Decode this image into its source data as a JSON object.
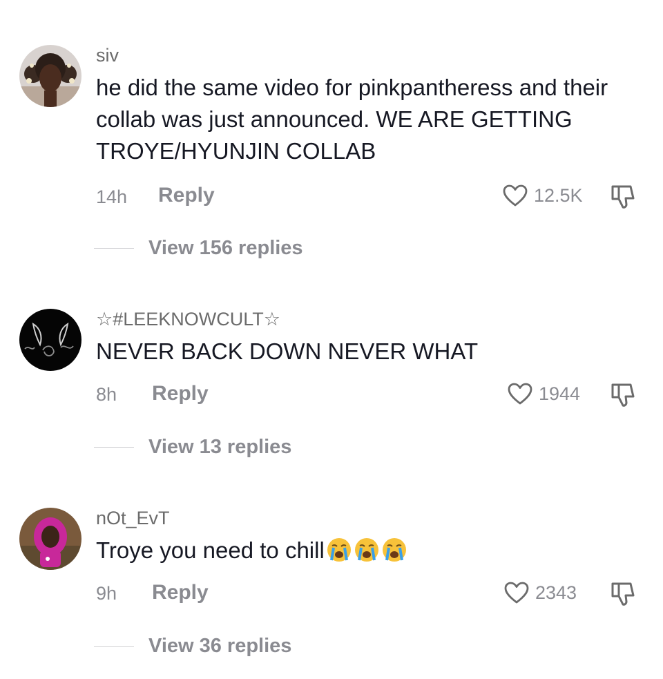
{
  "comments": [
    {
      "username": "siv",
      "text": "he did the same video for pinkpantheress and their collab was just announced. WE ARE GETTING TROYE/HYUNJIN COLLAB",
      "time": "14h",
      "reply_label": "Reply",
      "likes": "12.5K",
      "view_replies": "View 156 replies"
    },
    {
      "username": "☆#LEEKNOWCULT☆",
      "text": "NEVER BACK DOWN NEVER WHAT",
      "time": "8h",
      "reply_label": "Reply",
      "likes": "1944",
      "view_replies": "View 13 replies"
    },
    {
      "username": "nOt_EvT",
      "text": "Troye you need to chill",
      "emojis": [
        "loudly-crying-face",
        "loudly-crying-face",
        "loudly-crying-face"
      ],
      "time": "9h",
      "reply_label": "Reply",
      "likes": "2343",
      "view_replies": "View 36 replies"
    }
  ],
  "icons": {
    "like": "heart-outline-icon",
    "dislike": "thumbs-down-outline-icon"
  },
  "colors": {
    "primary_text": "#161823",
    "secondary_text": "#8a8b91",
    "username_text": "#6b6b6b",
    "divider": "#cfcfd2"
  }
}
